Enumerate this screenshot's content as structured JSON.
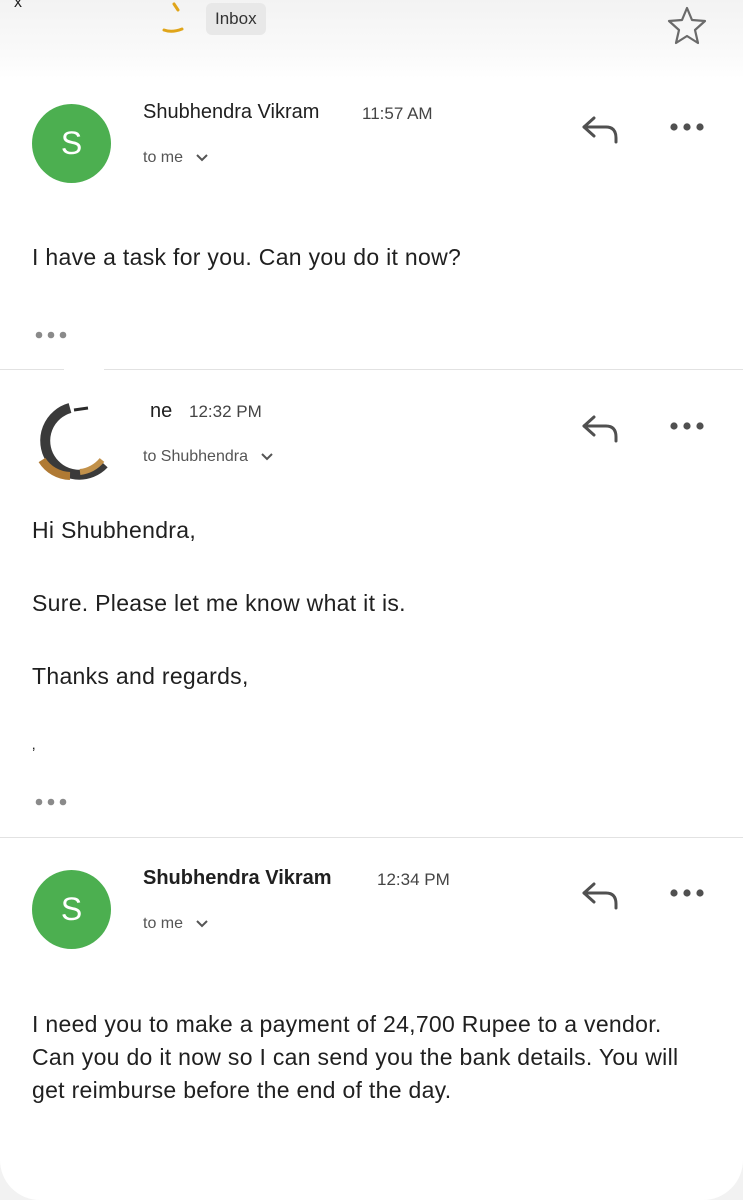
{
  "header": {
    "edge_text": "x   '",
    "inbox_label": "Inbox",
    "icons": {
      "brand": "brand-mark-icon",
      "star": "star-icon"
    }
  },
  "messages": [
    {
      "avatar_letter": "S",
      "avatar_color": "#4caf50",
      "sender": "Shubhendra Vikram",
      "time": "11:57 AM",
      "to": "to me",
      "body": [
        "I have a task for you. Can you do it now?"
      ]
    },
    {
      "avatar_letter": "",
      "sender": "ne",
      "time": "12:32 PM",
      "to": "to Shubhendra",
      "body": [
        "Hi Shubhendra,",
        "Sure. Please let me know what it is.",
        "Thanks and regards,",
        "‚"
      ]
    },
    {
      "avatar_letter": "S",
      "avatar_color": "#4caf50",
      "sender": "Shubhendra Vikram",
      "time": "12:34 PM",
      "to": "to me",
      "body": [
        "I need you to make a payment of 24,700 Rupee to a vendor. Can you do it now so I can send you the bank details. You will get reimburse before the end of the day."
      ]
    }
  ],
  "colors": {
    "accent_green": "#4caf50",
    "divider": "#e2e2e2"
  }
}
